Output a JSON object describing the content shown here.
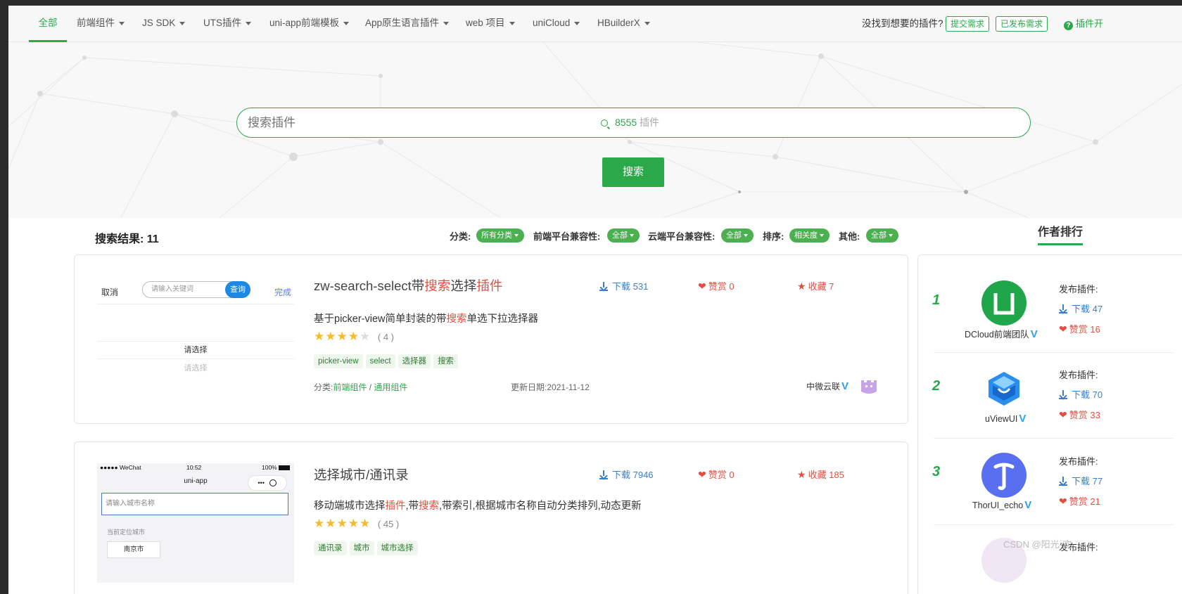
{
  "nav": {
    "items": [
      {
        "label": "全部",
        "active": true,
        "dropdown": false
      },
      {
        "label": "前端组件",
        "dropdown": true
      },
      {
        "label": "JS SDK",
        "dropdown": true
      },
      {
        "label": "UTS插件",
        "dropdown": true
      },
      {
        "label": "uni-app前端模板",
        "dropdown": true
      },
      {
        "label": "App原生语言插件",
        "dropdown": true
      },
      {
        "label": "web 项目",
        "dropdown": true
      },
      {
        "label": "uniCloud",
        "dropdown": true
      },
      {
        "label": "HBuilderX",
        "dropdown": true
      }
    ],
    "prompt": "没找到想要的插件?",
    "submit_request": "提交需求",
    "published_requests": "已发布需求",
    "developer_link": "插件开"
  },
  "search": {
    "placeholder": "搜索插件",
    "count": "8555",
    "count_label": "插件",
    "button": "搜索"
  },
  "filters": {
    "results_label": "搜索结果: 11",
    "category_label": "分类:",
    "category_value": "所有分类",
    "frontend_label": "前端平台兼容性:",
    "frontend_value": "全部",
    "cloud_label": "云端平台兼容性:",
    "cloud_value": "全部",
    "sort_label": "排序:",
    "sort_value": "相关度",
    "other_label": "其他:",
    "other_value": "全部"
  },
  "author_rank_tab": "作者排行",
  "plugins": [
    {
      "title_a": "zw-search-select带",
      "title_b": "搜索",
      "title_c": "选择",
      "title_d": "插件",
      "downloads": "下载 531",
      "tips": "赞赏 0",
      "favorites": "收藏 7",
      "desc_a": "基于picker-view简单封装的带",
      "desc_b": "搜索",
      "desc_c": "单选下拉选择器",
      "rating": 4,
      "rating_count": "( 4 )",
      "tags": [
        "picker-view",
        "select",
        "选择器",
        "搜索"
      ],
      "category_prefix": "分类:",
      "category_main": "前端组件",
      "category_sep": " / ",
      "category_sub": "通用组件",
      "updated": "更新日期:2021-11-12",
      "author": "中微云联",
      "thumb": {
        "cancel": "取消",
        "input_placeholder": "请输入关键词",
        "query": "查询",
        "done": "完成",
        "option_selected": "请选择",
        "option_next": "请选择"
      }
    },
    {
      "title": "选择城市/通讯录",
      "downloads": "下载 7946",
      "tips": "赞赏 0",
      "favorites": "收藏 185",
      "desc_a": "移动端城市选择",
      "desc_b": "插件",
      "desc_c": ",带",
      "desc_d": "搜索",
      "desc_e": ",带索引,根据城市名称自动分类排列,动态更新",
      "rating": 5,
      "rating_count": "( 45 )",
      "tags": [
        "通讯录",
        "城市",
        "城市选择"
      ],
      "thumb": {
        "signal": "●●●●● WeChat",
        "time": "10:52",
        "battery": "100%",
        "title": "uni-app",
        "caps": "•••",
        "input_placeholder": "请输入城市名称",
        "location_label": "当前定位城市",
        "city": "南京市"
      }
    }
  ],
  "ranking": [
    {
      "rank": "1",
      "name": "DCloud前端团队",
      "published_label": "发布插件:",
      "downloads": "下载 47",
      "tips": "赞赏 16"
    },
    {
      "rank": "2",
      "name": "uViewUI",
      "published_label": "发布插件:",
      "downloads": "下载 70",
      "tips": "赞赏 33"
    },
    {
      "rank": "3",
      "name": "ThorUI_echo",
      "published_label": "发布插件:",
      "downloads": "下载 77",
      "tips": "赞赏 21"
    },
    {
      "published_label": "发布插件:"
    }
  ],
  "watermark": "CSDN @阳光-欢",
  "colors": {
    "brand": "#2aa84a",
    "highlight": "#e54d42",
    "link": "#3a7dc9",
    "star": "#f7ba2a"
  }
}
